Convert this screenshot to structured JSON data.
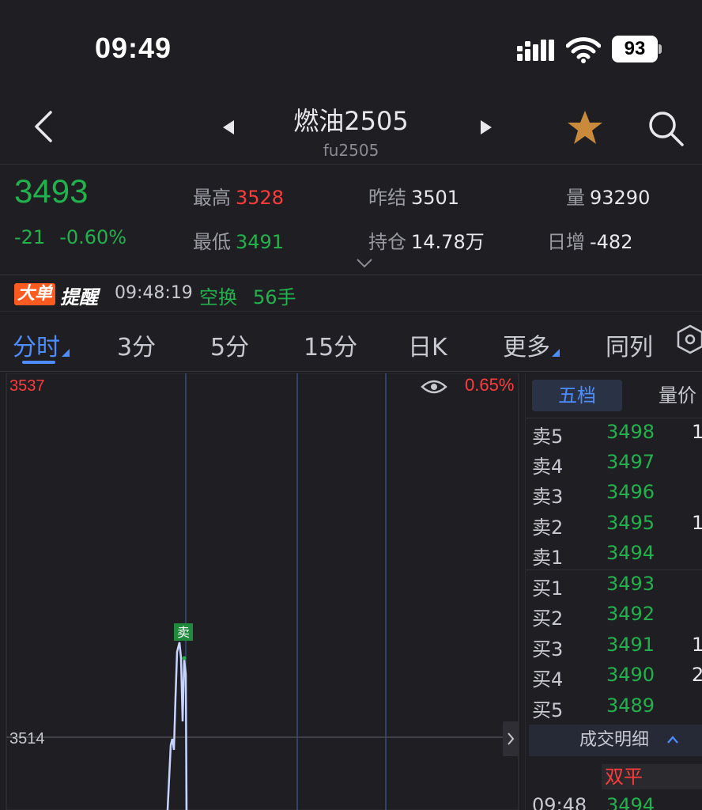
{
  "status_bar": {
    "time": "09:49",
    "battery": "93"
  },
  "nav": {
    "title": "燃油2505",
    "subtitle": "fu2505"
  },
  "quote": {
    "last_price": "3493",
    "change": "-21",
    "change_pct": "-0.60%",
    "high_label": "最高",
    "high": "3528",
    "low_label": "最低",
    "low": "3491",
    "prev_settle_label": "昨结",
    "prev_settle": "3501",
    "open_interest_label": "持仓",
    "open_interest": "14.78万",
    "volume_label": "量",
    "volume": "93290",
    "daily_change_label": "日增",
    "daily_change": "-482"
  },
  "alert": {
    "badge1": "大单",
    "badge2": "提醒",
    "time": "09:48:19",
    "type": "空换",
    "qty": "56手"
  },
  "tabs": [
    "分时",
    "3分",
    "5分",
    "15分",
    "日K",
    "更多",
    "同列"
  ],
  "chart": {
    "top_price": "3537",
    "mid_price": "3514",
    "top_pct": "0.65%",
    "marker": "卖",
    "colors": {
      "up": "#ff3b3b",
      "down": "#22b14c",
      "line": "#c8d4ff"
    }
  },
  "orderbook": {
    "tab_active": "五档",
    "tab_other": "量价",
    "asks": [
      {
        "label": "卖5",
        "price": "3498",
        "vol": "1"
      },
      {
        "label": "卖4",
        "price": "3497",
        "vol": ""
      },
      {
        "label": "卖3",
        "price": "3496",
        "vol": ""
      },
      {
        "label": "卖2",
        "price": "3495",
        "vol": "1"
      },
      {
        "label": "卖1",
        "price": "3494",
        "vol": ""
      }
    ],
    "bids": [
      {
        "label": "买1",
        "price": "3493",
        "vol": ""
      },
      {
        "label": "买2",
        "price": "3492",
        "vol": ""
      },
      {
        "label": "买3",
        "price": "3491",
        "vol": "1"
      },
      {
        "label": "买4",
        "price": "3490",
        "vol": "2"
      },
      {
        "label": "买5",
        "price": "3489",
        "vol": ""
      }
    ],
    "deals_title": "成交明细",
    "deal_type": "双平",
    "deal_time": "09:48",
    "deal_price": "3494"
  }
}
